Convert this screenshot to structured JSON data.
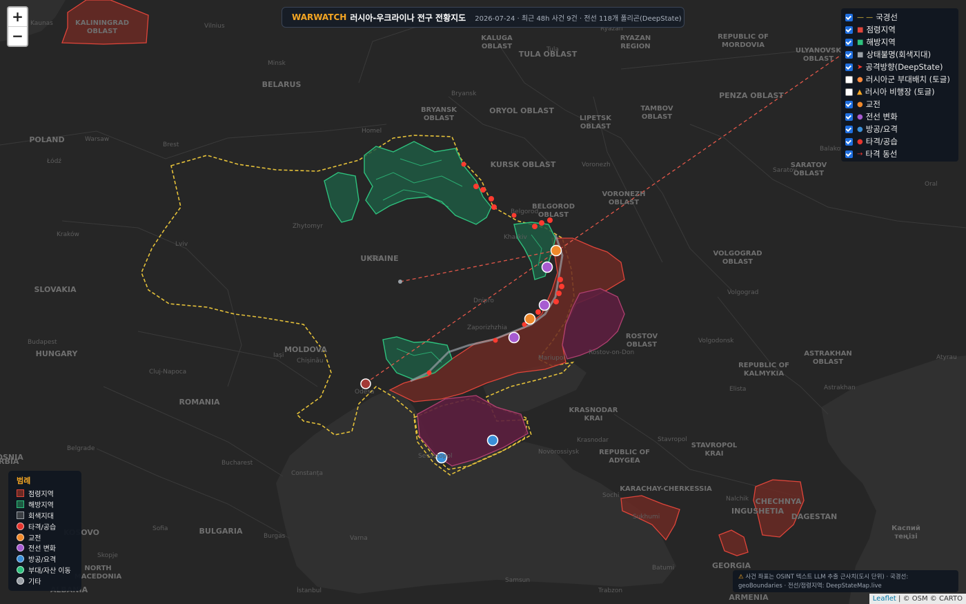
{
  "title": {
    "brand": "WARWATCH",
    "main": "러시아-우크라이나 전구 전황지도",
    "meta": "2026-07-24 · 최근 48h 사건 9건 · 전선 118개 폴리곤(DeepState)"
  },
  "zoom": {
    "in": "+",
    "out": "−"
  },
  "layers": [
    {
      "label": "국경선",
      "symbol": "— —",
      "color": "#e6c23a",
      "checked": true
    },
    {
      "label": "점령지역",
      "symbol": "■",
      "color": "#e0453a",
      "checked": true
    },
    {
      "label": "해방지역",
      "symbol": "■",
      "color": "#2ec27e",
      "checked": true
    },
    {
      "label": "상태불명(회색지대)",
      "symbol": "■",
      "color": "#9aa0a6",
      "checked": true
    },
    {
      "label": "공격방향(DeepState)",
      "symbol": "➤",
      "color": "#ff3b30",
      "checked": true
    },
    {
      "label": "러시아군 부대배치 (토글)",
      "symbol": "●",
      "color": "#ff8a3d",
      "checked": false
    },
    {
      "label": "러시아 비행장 (토글)",
      "symbol": "▲",
      "color": "#f5a623",
      "checked": false
    },
    {
      "label": "교전",
      "symbol": "●",
      "color": "#f0892b",
      "checked": true
    },
    {
      "label": "전선 변화",
      "symbol": "●",
      "color": "#a75bd1",
      "checked": true
    },
    {
      "label": "방공/요격",
      "symbol": "●",
      "color": "#3a8fd8",
      "checked": true
    },
    {
      "label": "타격/공습",
      "symbol": "●",
      "color": "#e5352e",
      "checked": true
    },
    {
      "label": "타격 동선",
      "symbol": "→",
      "color": "#e5352e",
      "checked": true
    }
  ],
  "legend": {
    "title": "범례",
    "items": [
      {
        "label": "점령지역",
        "kind": "square",
        "fill": "#6b2a24",
        "stroke": "#e0453a"
      },
      {
        "label": "해방지역",
        "kind": "square",
        "fill": "#1e5a43",
        "stroke": "#2ec27e"
      },
      {
        "label": "회색지대",
        "kind": "square",
        "fill": "#3b3f44",
        "stroke": "#9aa0a6"
      },
      {
        "label": "타격/공습",
        "kind": "dot",
        "fill": "#e5352e"
      },
      {
        "label": "교전",
        "kind": "dot",
        "fill": "#f0892b"
      },
      {
        "label": "전선 변화",
        "kind": "dot",
        "fill": "#a75bd1"
      },
      {
        "label": "방공/요격",
        "kind": "dot",
        "fill": "#3a8fd8"
      },
      {
        "label": "부대/자산 이동",
        "kind": "dot",
        "fill": "#2ec27e"
      },
      {
        "label": "기타",
        "kind": "dot",
        "fill": "#9aa0a6"
      }
    ]
  },
  "note": {
    "icon": "⚠",
    "line1": "사건 좌표는 OSINT 텍스트 LLM 추출 근사치(도시 단위) · 국경선:",
    "line2": "geoBoundaries · 전선/점령지역: DeepStateMap.live"
  },
  "attribution": {
    "leaflet": "Leaflet",
    "rest": "| © OSM © CARTO"
  },
  "map_labels": {
    "regions": [
      "KALININGRAD OBLAST",
      "KALUGA OBLAST",
      "TULA OBLAST",
      "RYAZAN REGION",
      "REPUBLIC OF MORDOVIA",
      "ULYANOVSK OBLAST",
      "BELARUS",
      "BRYANSK OBLAST",
      "ORYOL OBLAST",
      "LIPETSK OBLAST",
      "TAMBOV OBLAST",
      "PENZA OBLAST",
      "POLAND",
      "KURSK OBLAST",
      "SARATOV OBLAST",
      "BELGOROD OBLAST",
      "VORONEZH OBLAST",
      "UKRAINE",
      "SLOVAKIA",
      "VOLGOGRAD OBLAST",
      "HUNGARY",
      "MOLDOVA",
      "ROSTOV OBLAST",
      "REPUBLIC OF KALMYKIA",
      "ASTRAKHAN OBLAST",
      "ROMANIA",
      "KRASNODAR KRAI",
      "REPUBLIC OF ADYGEA",
      "STAVROPOL KRAI",
      "SERBIA",
      "KOSOVO",
      "BULGARIA",
      "NORTH MACEDONIA",
      "KARACHAY-CHERKESSIA",
      "CHECHNYA",
      "DAGESTAN",
      "INGUSHETIA",
      "GEORGIA",
      "ALBANIA",
      "ARMENIA",
      "BOSNIA",
      "Каспий теңізі"
    ],
    "cities": [
      "Vilnius",
      "Kaunas",
      "Minsk",
      "Homel",
      "Bryansk",
      "Ryazan",
      "Tula",
      "Warsaw",
      "Brest",
      "Łódź",
      "Kraków",
      "Lviv",
      "Zhytomyr",
      "Kyiv",
      "Kharkiv",
      "Belgorod",
      "Voronezh",
      "Balakovo",
      "Saratov",
      "Oral",
      "Dnipro",
      "Zaporizhzhia",
      "Mariupol",
      "Rostov-on-Don",
      "Volgograd",
      "Volgodonsk",
      "Elista",
      "Atyrau",
      "Astrakhan",
      "Budapest",
      "Cluj-Napoca",
      "Iași",
      "Chișinău",
      "Odesa",
      "Bucharest",
      "Constanța",
      "Belgrade",
      "Sofia",
      "Burgas",
      "Skopje",
      "Varna",
      "Sevastopol",
      "Krasnodar",
      "Novorossiysk",
      "Stavropol",
      "Sochi",
      "Sukhumi",
      "Nalchik",
      "Batumi",
      "Samsun",
      "Trabzon",
      "İstanbul"
    ]
  }
}
